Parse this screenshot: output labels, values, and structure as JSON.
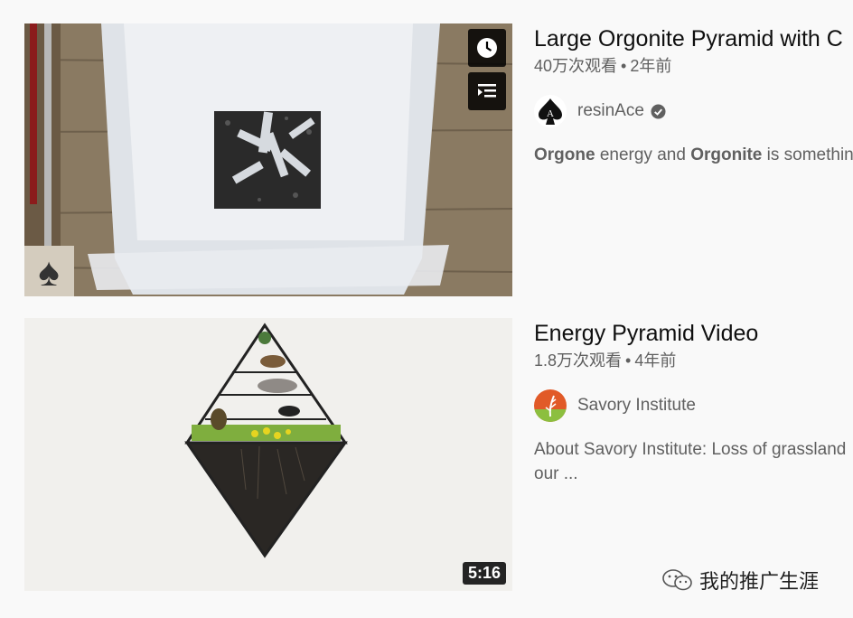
{
  "results": [
    {
      "title": "Large Orgonite Pyramid with C",
      "views": "40万次观看",
      "separator": "•",
      "age": "2年前",
      "channel": "resinAce",
      "verified": true,
      "description_parts": [
        {
          "text": "Orgone",
          "bold": true
        },
        {
          "text": " energy and ",
          "bold": false
        },
        {
          "text": "Orgonite",
          "bold": true
        },
        {
          "text": " is something",
          "bold": false
        }
      ],
      "hover_icons": [
        "clock-icon",
        "queue-icon"
      ]
    },
    {
      "title": "Energy Pyramid Video",
      "views": "1.8万次观看",
      "separator": "•",
      "age": "4年前",
      "channel": "Savory Institute",
      "verified": false,
      "description_line1": "About Savory Institute: Loss of grassland",
      "description_line2": "our ...",
      "duration": "5:16"
    }
  ],
  "watermark": {
    "text": "我的推广生涯",
    "icon": "wechat-icon"
  },
  "colors": {
    "title": "#0f0f0f",
    "meta": "#606060",
    "background": "#f9f9f9"
  }
}
